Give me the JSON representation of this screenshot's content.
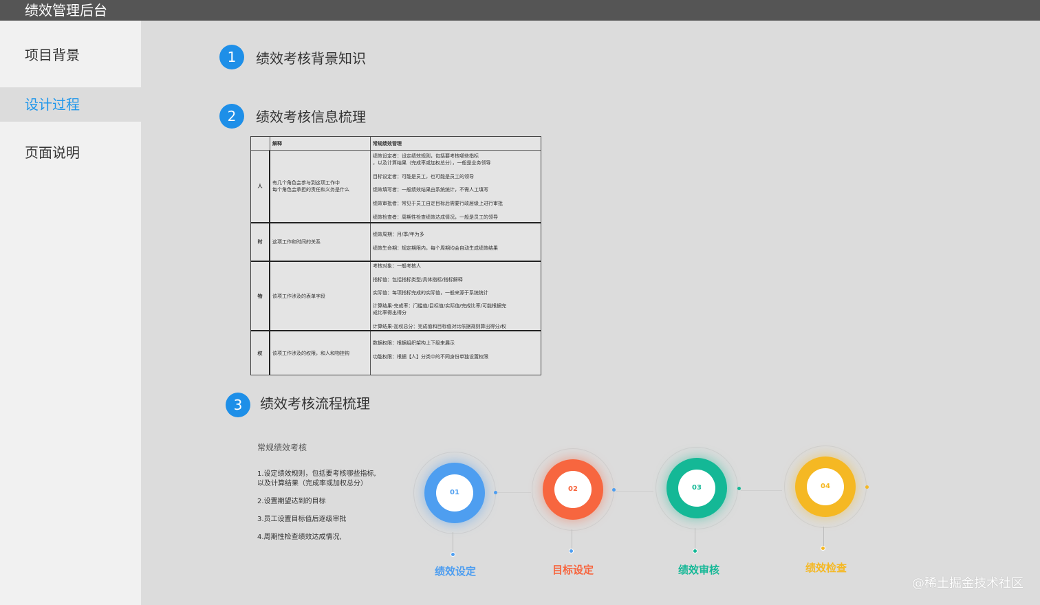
{
  "app": {
    "title": "绩效管理后台"
  },
  "sidebar": {
    "items": [
      {
        "label": "项目背景"
      },
      {
        "label": "设计过程"
      },
      {
        "label": "页面说明"
      }
    ]
  },
  "sections": [
    {
      "num": "1",
      "title": "绩效考核背景知识"
    },
    {
      "num": "2",
      "title": "绩效考核信息梳理"
    },
    {
      "num": "3",
      "title": "绩效考核流程梳理"
    }
  ],
  "table": {
    "header": {
      "c0": "",
      "c1": "解释",
      "c2": "常规绩效管理"
    },
    "rows": [
      {
        "key": "人",
        "desc": [
          "有几个角色会参与到这项工作中",
          "每个角色会承担的责任和义务是什么"
        ],
        "lines": [
          "绩效设定者：设定绩效规则，包括要考核哪些指标",
          "，以及计算结果（完成率或加权总分），一般是业务领导",
          "目标设定者：可能是员工，也可能是员工的领导",
          "绩效填写者：一般绩效结果由系统统计，不需人工填写",
          "绩效审批者：常见于员工自定目标后需要行政层级上进行审批",
          "绩效检查者：周期性检查绩效达成情况，一般是员工的领导"
        ]
      },
      {
        "key": "时",
        "desc": [
          "这项工作和时间的关系"
        ],
        "lines": [
          "绩效周期：月/季/年为多",
          "绩效生命期：规定期限内，每个周期均会自动生成绩效结果"
        ]
      },
      {
        "key": "物",
        "desc": [
          "该项工作涉及的表单字段"
        ],
        "lines": [
          "考核对象：一般考核人",
          "指标值：包括指标类型/具体指标/指标解释",
          "实际值：每项指标完成的实际值，一般来源于系统统计",
          "计算结果-完成率：门槛值/目标值/实际值/完成比率/可能根据完",
          "成比率得出得分",
          "计算结果-加权总分：完成值和目标值对比依据规则算出得分/权"
        ]
      },
      {
        "key": "权",
        "desc": [
          "该项工作涉及的权限，和人和物挂钩"
        ],
        "lines": [
          "数据权限：根据组织架构上下级来展示",
          "功能权限：根据【人】分类中的不同身份单独设置权限"
        ]
      }
    ]
  },
  "flow": {
    "heading": "常规绩效考核",
    "steps": [
      "1.设定绩效规则，包括要考核哪些指标,",
      "以及计算结果（完成率或加权总分）",
      "2.设置期望达到的目标",
      "3.员工设置目标值后逐级审批",
      "4.周期性检查绩效达成情况,"
    ]
  },
  "stages": [
    {
      "num": "01",
      "label": "绩效设定",
      "color": "#4e9ef0"
    },
    {
      "num": "02",
      "label": "目标设定",
      "color": "#f7663f"
    },
    {
      "num": "03",
      "label": "绩效审核",
      "color": "#14b896"
    },
    {
      "num": "04",
      "label": "绩效检查",
      "color": "#f5b823"
    }
  ],
  "watermark": "@稀土掘金技术社区"
}
